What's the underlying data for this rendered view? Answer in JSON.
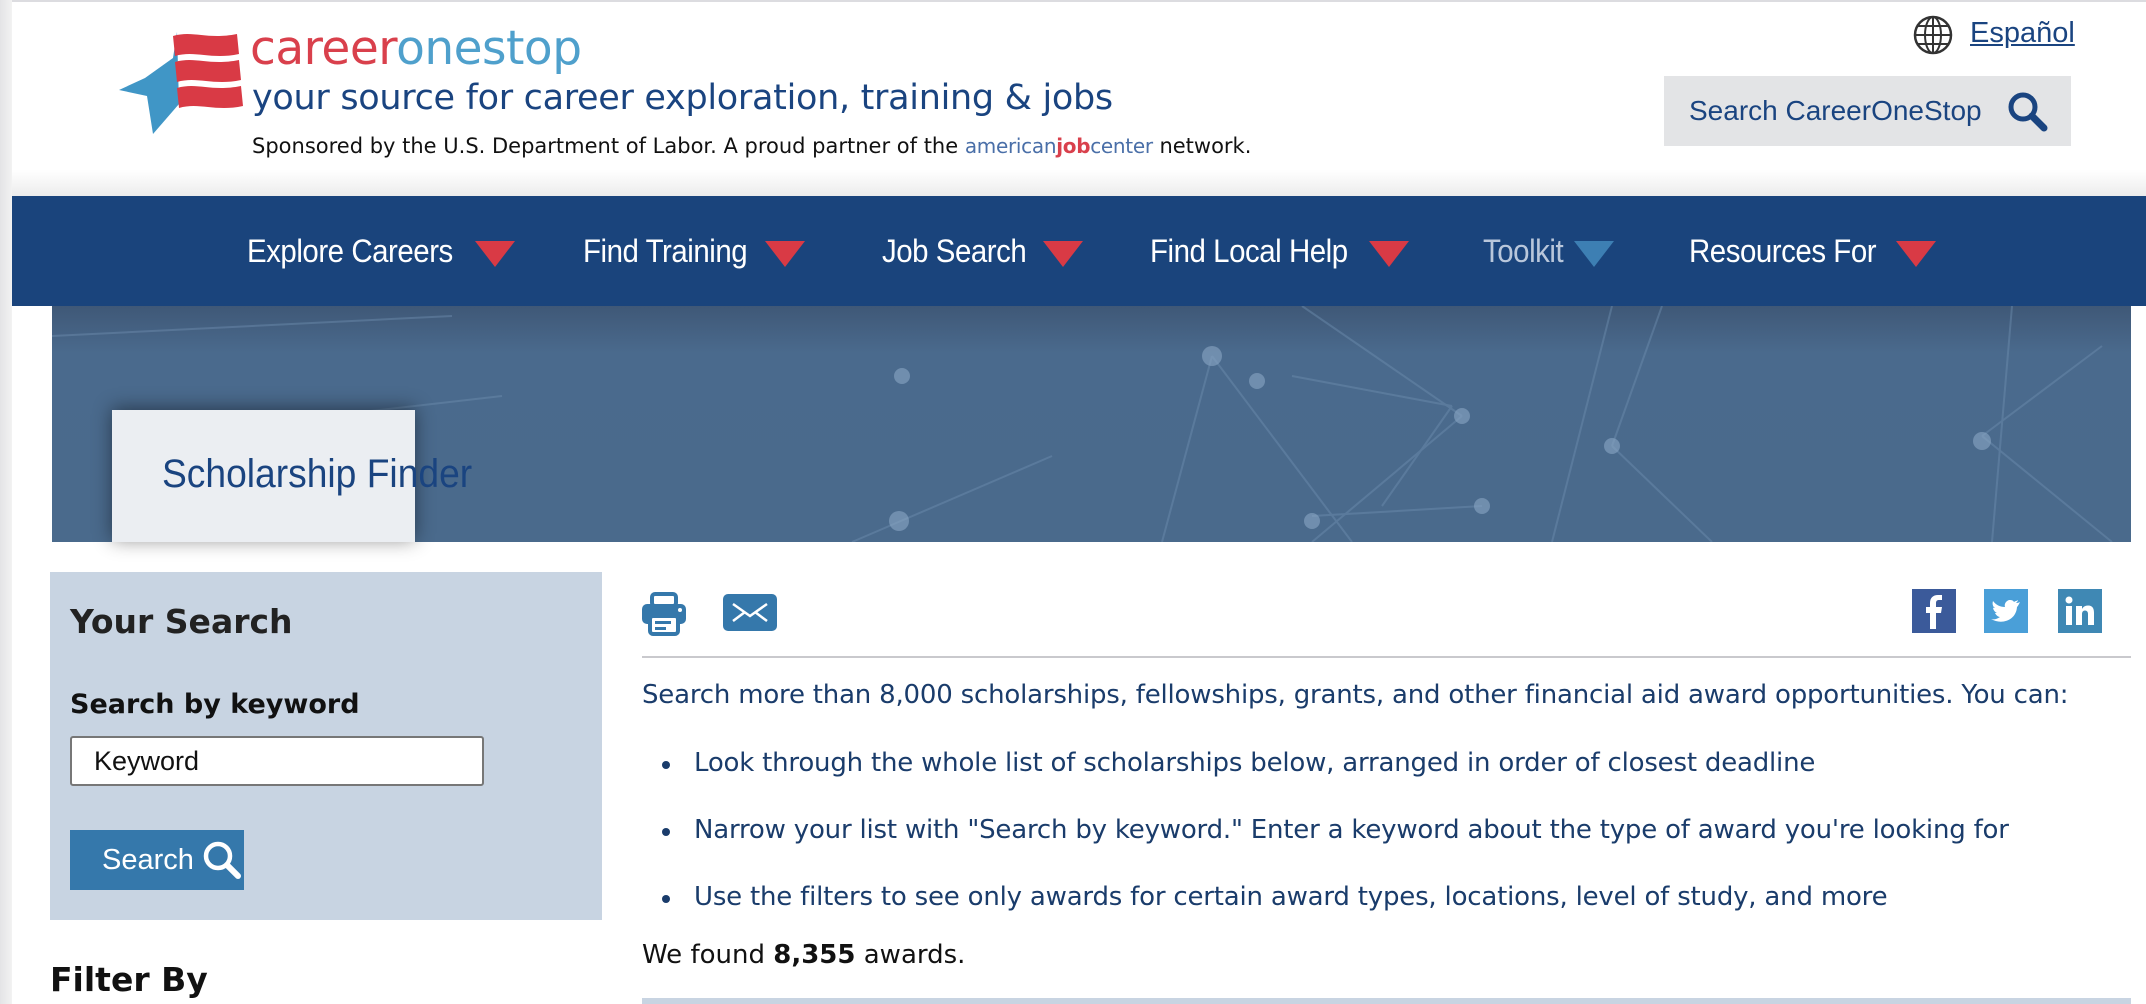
{
  "header": {
    "brand_part1": "career",
    "brand_part2": "onestop",
    "tagline": "your source for career exploration, training & jobs",
    "sponsor_text_before": "Sponsored by the U.S. Department of Labor. A proud partner of the ",
    "ajc_part1": "american",
    "ajc_part2": "job",
    "ajc_part3": "center",
    "sponsor_text_after": " network.",
    "language_link": "Español",
    "site_search_label": "Search CareerOneStop"
  },
  "nav": {
    "items": [
      {
        "label": "Explore Careers",
        "icon": "dropdown-triangle-red"
      },
      {
        "label": "Find Training",
        "icon": "dropdown-triangle-red"
      },
      {
        "label": "Job Search",
        "icon": "dropdown-triangle-red"
      },
      {
        "label": "Find Local Help",
        "icon": "dropdown-triangle-red"
      },
      {
        "label": "Toolkit",
        "icon": "dropdown-triangle-blue"
      },
      {
        "label": "Resources For",
        "icon": "dropdown-triangle-red"
      }
    ]
  },
  "banner": {
    "title": "Scholarship Finder"
  },
  "sidebar": {
    "heading": "Your Search",
    "keyword_label": "Search by keyword",
    "keyword_placeholder": "Keyword",
    "keyword_value": "",
    "search_button": "Search",
    "filter_heading": "Filter By"
  },
  "main": {
    "tools": [
      "print-icon",
      "email-icon"
    ],
    "social": [
      "facebook",
      "twitter",
      "linkedin"
    ],
    "intro": "Search more than 8,000 scholarships, fellowships, grants, and other financial aid award opportunities. You can:",
    "bullets": [
      "Look through the whole list of scholarships below, arranged in order of closest deadline",
      "Narrow your list with \"Search by keyword.\" Enter a keyword about the type of award you're looking for",
      "Use the filters to see only awards for certain award types, locations, level of study, and more"
    ],
    "found_prefix": "We found ",
    "found_count": "8,355",
    "found_suffix": " awards."
  },
  "colors": {
    "nav_bg": "#1a447c",
    "accent_red": "#d93a45",
    "brand_blue": "#1a4480",
    "button_blue": "#3578ab",
    "panel_bg": "#c8d4e2"
  }
}
